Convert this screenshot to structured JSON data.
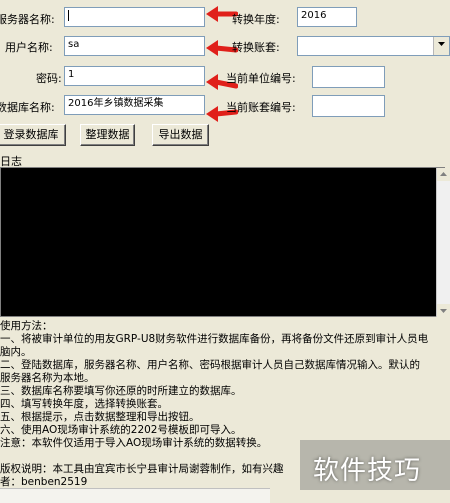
{
  "form": {
    "server_label": "服务器名称:",
    "server_value": "",
    "username_label": "用户名称:",
    "username_value": "sa",
    "password_label": "密码:",
    "password_value": "1",
    "dbname_label": "数据库名称:",
    "dbname_value": "2016年乡镇数据采集",
    "year_label": "转换年度:",
    "year_value": "2016",
    "account_label": "转换账套:",
    "account_value": "",
    "unit_label": "当前单位编号:",
    "unit_value": "",
    "ledger_label": "当前账套编号:",
    "ledger_value": ""
  },
  "buttons": {
    "login": "登录数据库",
    "organize": "整理数据",
    "export": "导出数据"
  },
  "log": {
    "label": "日志"
  },
  "help": {
    "lines": [
      "使用方法：",
      "一、将被审计单位的用友GRP-U8财务软件进行数据库备份，再将备份文件还原到审计人员电",
      "脑内。",
      "二、登陆数据库，服务器名称、用户名称、密码根据审计人员自己数据库情况输入。默认的",
      "服务器名称为本地。",
      "三、数据库名称要填写你还原的时所建立的数据库。",
      "四、填写转换年度，选择转换账套。",
      "五、根据提示，点击数据整理和导出按钮。",
      "六、使用AO现场审计系统的2202号模板即可导入。",
      "注意：本软件仅适用于导入AO现场审计系统的数据转换。",
      "",
      "    版权说明：本工具由宜宾市长宁县审计局谢蓉制作，如有兴趣",
      "者：benben2519"
    ]
  },
  "watermark": "软件技巧",
  "colors": {
    "annotation_arrow": "#e0201a",
    "log_bg": "#000000",
    "window_bg": "#ece9d8"
  }
}
